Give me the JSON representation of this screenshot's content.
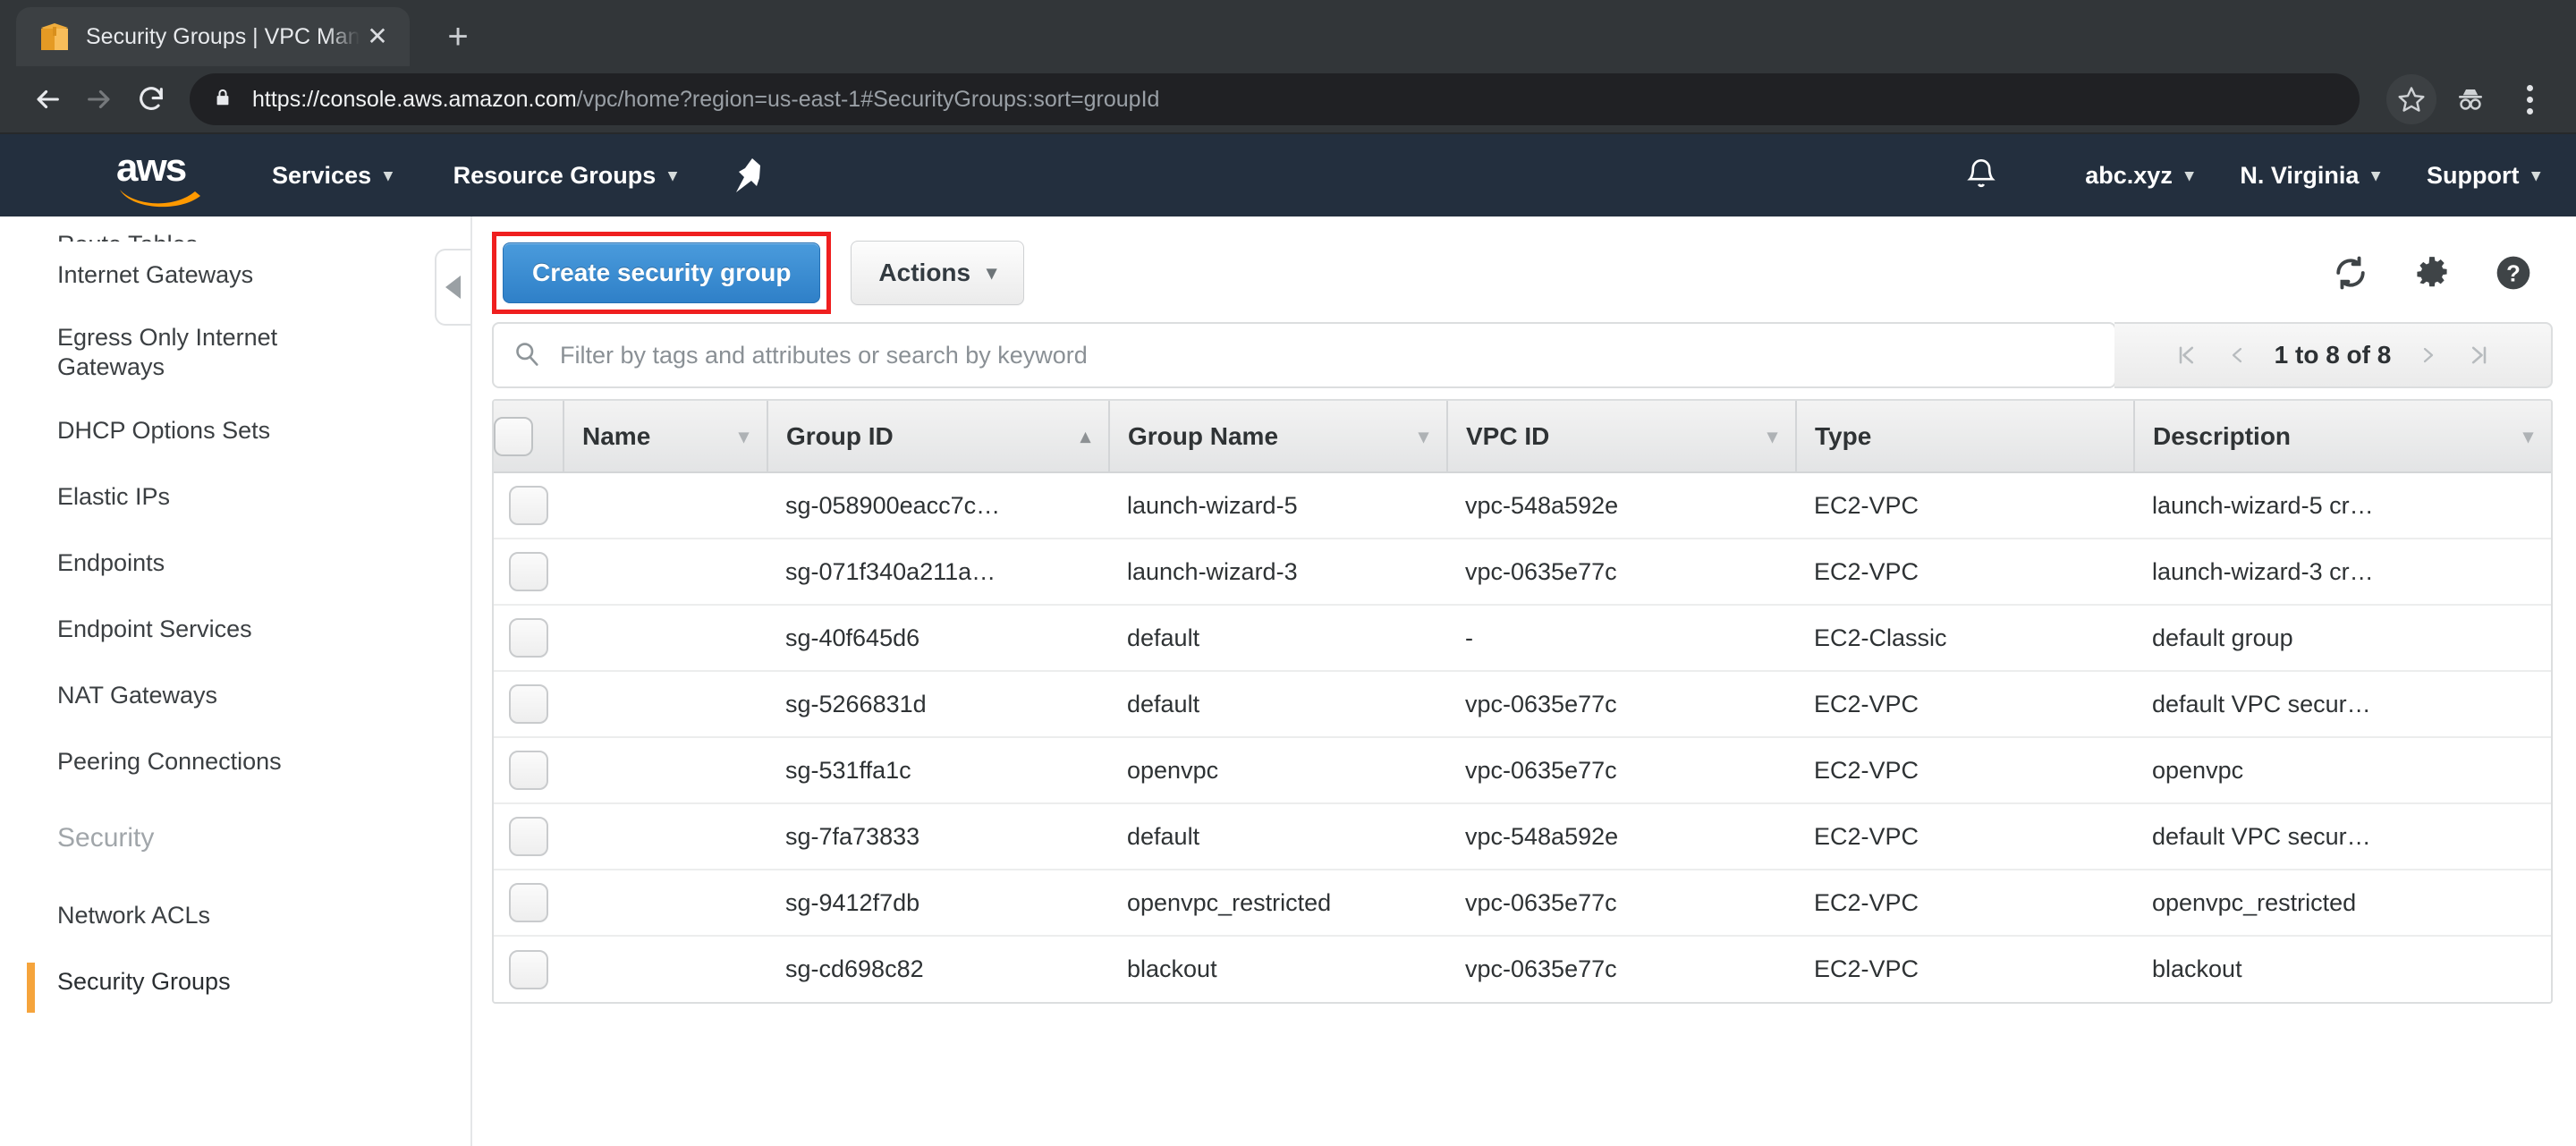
{
  "browser": {
    "tab": {
      "title": "Security Groups | VPC Management Console",
      "favicon": "orange-cube-icon",
      "close_label": "✕"
    },
    "new_tab_label": "+",
    "back_label": "←",
    "forward_label": "→",
    "reload_label": "↻",
    "url_full": "https://console.aws.amazon.com/vpc/home?region=us-east-1#SecurityGroups:sort=groupId",
    "url_scheme_host": "https://console.aws.amazon.com",
    "url_path": "/vpc/home?region=us-east-1#SecurityGroups:sort=groupId",
    "icons": [
      "lock-icon",
      "star-icon",
      "incognito-icon",
      "three-dot-menu-icon"
    ]
  },
  "awsnav": {
    "logo_text": "aws",
    "left_links": [
      {
        "label": "Services",
        "caret": "▾"
      },
      {
        "label": "Resource Groups",
        "caret": "▾"
      }
    ],
    "pin_icon": "pin-icon",
    "bell_icon": "bell-icon",
    "right_links": [
      {
        "label": "abc.xyz",
        "caret": "▾"
      },
      {
        "label": "N. Virginia",
        "caret": "▾"
      },
      {
        "label": "Support",
        "caret": "▾"
      }
    ],
    "bg_color": "#232f3e",
    "accent_color": "#ff9900"
  },
  "sidebar": {
    "items": [
      {
        "label": "Route Tables",
        "clipped": true,
        "active": false
      },
      {
        "label": "Internet Gateways",
        "active": false
      },
      {
        "label": "Egress Only Internet Gateways",
        "two_line": true,
        "active": false
      },
      {
        "label": "DHCP Options Sets",
        "active": false
      },
      {
        "label": "Elastic IPs",
        "active": false
      },
      {
        "label": "Endpoints",
        "active": false
      },
      {
        "label": "Endpoint Services",
        "active": false
      },
      {
        "label": "NAT Gateways",
        "active": false
      },
      {
        "label": "Peering Connections",
        "active": false
      }
    ],
    "section_header": "Security",
    "security_items": [
      {
        "label": "Network ACLs",
        "active": false
      },
      {
        "label": "Security Groups",
        "active": true
      }
    ],
    "active_indicator_color": "#f5a43c",
    "collapse_icon": "chevron-left-icon"
  },
  "toolbar": {
    "create_label": "Create security group",
    "actions_label": "Actions",
    "actions_caret": "▾",
    "highlight_color": "#ef1f1f",
    "primary_color": "#3a8dd2",
    "icons": [
      "refresh-icon",
      "gear-icon",
      "help-icon"
    ]
  },
  "search": {
    "placeholder": "Filter by tags and attributes or search by keyword",
    "value": "",
    "icon": "search-icon"
  },
  "pagination": {
    "first_label": "❘‹",
    "prev_label": "‹",
    "count_label": "1 to 8 of 8",
    "next_label": "›",
    "last_label": "›❘"
  },
  "table": {
    "select_all_checkbox": "select-all-checkbox",
    "columns": [
      {
        "label": "Name",
        "sort": "none"
      },
      {
        "label": "Group ID",
        "sort": "asc"
      },
      {
        "label": "Group Name",
        "sort": "none"
      },
      {
        "label": "VPC ID",
        "sort": "none"
      },
      {
        "label": "Type",
        "sort": "hidden"
      },
      {
        "label": "Description",
        "sort": "none"
      }
    ],
    "rows": [
      {
        "name": "",
        "group_id": "sg-058900eacc7c…",
        "group_name": "launch-wizard-5",
        "vpc_id": "vpc-548a592e",
        "type": "EC2-VPC",
        "description": "launch-wizard-5 cr…"
      },
      {
        "name": "",
        "group_id": "sg-071f340a211a…",
        "group_name": "launch-wizard-3",
        "vpc_id": "vpc-0635e77c",
        "type": "EC2-VPC",
        "description": "launch-wizard-3 cr…"
      },
      {
        "name": "",
        "group_id": "sg-40f645d6",
        "group_name": "default",
        "vpc_id": "-",
        "type": "EC2-Classic",
        "description": "default group"
      },
      {
        "name": "",
        "group_id": "sg-5266831d",
        "group_name": "default",
        "vpc_id": "vpc-0635e77c",
        "type": "EC2-VPC",
        "description": "default VPC secur…"
      },
      {
        "name": "",
        "group_id": "sg-531ffa1c",
        "group_name": "openvpc",
        "vpc_id": "vpc-0635e77c",
        "type": "EC2-VPC",
        "description": "openvpc"
      },
      {
        "name": "",
        "group_id": "sg-7fa73833",
        "group_name": "default",
        "vpc_id": "vpc-548a592e",
        "type": "EC2-VPC",
        "description": "default VPC secur…"
      },
      {
        "name": "",
        "group_id": "sg-9412f7db",
        "group_name": "openvpc_restricted",
        "vpc_id": "vpc-0635e77c",
        "type": "EC2-VPC",
        "description": "openvpc_restricted"
      },
      {
        "name": "",
        "group_id": "sg-cd698c82",
        "group_name": "blackout",
        "vpc_id": "vpc-0635e77c",
        "type": "EC2-VPC",
        "description": "blackout"
      }
    ]
  }
}
